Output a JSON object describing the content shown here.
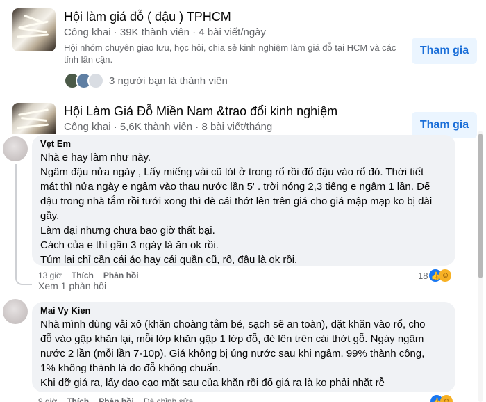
{
  "groups": [
    {
      "name": "Hội làm giá đỗ ( đậu ) TPHCM",
      "meta": "Công khai · 39K thành viên · 4 bài viết/ngày",
      "description": "Hội nhóm chuyên giao lưu, học hỏi, chia sẻ kinh nghiệm làm giá đỗ tại HCM và các tỉnh lân cận.",
      "friends_text": "3 người bạn là thành viên",
      "join_label": "Tham gia"
    },
    {
      "name": "Hội Làm Giá Đỗ Miền Nam &trao đổi kinh nghiệm",
      "meta": "Công khai · 5,6K thành viên · 8 bài viết/tháng",
      "join_label": "Tham gia"
    }
  ],
  "comments": [
    {
      "author": "Vẹt Em",
      "lines": [
        "Nhà e hay làm như này.",
        "Ngâm đậu nửa ngày , Lấy miếng vải cũ lót ở trong rổ rồi đổ đậu vào rổ đó. Thời tiết",
        "mát thì nửa ngày e ngâm vào thau nước lần 5' . trời nóng 2,3 tiếng e ngâm 1 lần. Để",
        "đậu trong nhà tắm rồi tưới xong thì đè cái thớt lên trên giá cho giá mập mạp ko bị dài",
        "gầy.",
        "Làm đại nhưng chưa bao giờ thất bại.",
        "Cách của e thì gần 3 ngày là ăn ok rồi.",
        "Túm lại chỉ cần cái áo hay cái quần cũ, rổ, đậu là ok rồi."
      ],
      "time": "13 giờ",
      "like_label": "Thích",
      "reply_label": "Phản hồi",
      "reaction_count": "18",
      "view_replies": "Xem 1 phản hồi"
    },
    {
      "author": "Mai Vy Kien",
      "lines": [
        "Nhà mình dùng vải xô (khăn choàng tắm bé, sạch sẽ an toàn), đặt khăn vào rổ, cho",
        "đỗ vào gập khăn lại, mỗi lớp khăn gập 1 lớp đỗ, đè lên trên cái thớt gỗ. Ngày ngâm",
        "nước 2 lần (mỗi lần 7-10p). Giá không bị úng nước sau khi ngâm. 99% thành công,",
        "1% không thành là do đỗ không chuẩn.",
        "Khi dỡ giá ra, lấy dao cạo mặt sau của khăn rồi đổ giá ra là ko phải nhặt rễ"
      ],
      "time": "9 giờ",
      "like_label": "Thích",
      "reply_label": "Phản hồi",
      "edited_label": "Đã chỉnh sửa"
    }
  ],
  "icons": {
    "like": "thumbs-up-icon",
    "haha": "haha-icon"
  }
}
